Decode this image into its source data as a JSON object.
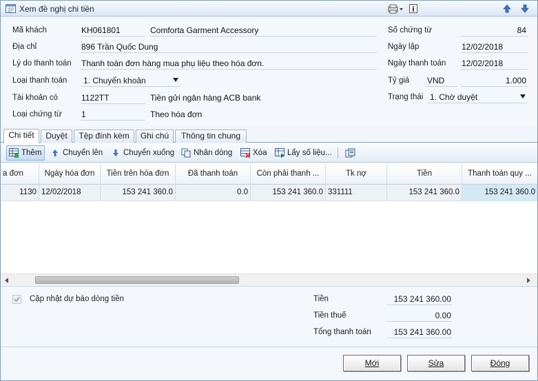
{
  "window": {
    "title": "Xem đề nghị chi tiền"
  },
  "form": {
    "customer_code_label": "Mã khách",
    "customer_code": "KH061801",
    "customer_name": "Comforta Garment Accessory",
    "address_label": "Địa chỉ",
    "address": "896 Trần Quốc Dung",
    "reason_label": "Lý do thanh toán",
    "reason": "Thanh toán đơn hàng mua phụ liệu theo hóa đơn.",
    "payment_type_label": "Loại thanh toán",
    "payment_type": "1. Chuyển khoản",
    "credit_account_label": "Tài khoản có",
    "credit_account": "1122TT",
    "credit_account_name": "Tiền gửi ngân hàng ACB bank",
    "doc_type_label": "Loại chứng từ",
    "doc_type": "1",
    "doc_type_name": "Theo hóa đơn",
    "voucher_no_label": "Số chứng từ",
    "voucher_no": "84",
    "created_date_label": "Ngày lập",
    "created_date": "12/02/2018",
    "payment_date_label": "Ngày thanh toán",
    "payment_date": "12/02/2018",
    "rate_label": "Tỷ giá",
    "currency": "VND",
    "rate": "1.000",
    "status_label": "Trạng thái",
    "status": "1. Chờ duyệt"
  },
  "tabs": [
    "Chi tiết",
    "Duyệt",
    "Tệp đính kèm",
    "Ghi chú",
    "Thông tin chung"
  ],
  "toolbar": {
    "add": "Thêm",
    "move_up": "Chuyển lên",
    "move_down": "Chuyển xuống",
    "copy_row": "Nhân dòng",
    "delete": "Xóa",
    "get_data": "Lấy số liệu..."
  },
  "grid": {
    "columns": [
      "a đơn",
      "Ngày hóa đơn",
      "Tiền trên hóa đơn",
      "Đã thanh toán",
      "Còn phải thanh ...",
      "Tk nợ",
      "Tiền",
      "Thanh toán quy ..."
    ],
    "rows": [
      [
        "1130",
        "12/02/2018",
        "153 241 360.0",
        "0.0",
        "153 241 360.0",
        "331111",
        "153 241 360.0",
        "153 241 360.0"
      ]
    ]
  },
  "bottom": {
    "cashflow_label": "Cập nhật dự báo dòng tiền",
    "cashflow_checked": true,
    "amount_label": "Tiền",
    "amount": "153 241 360.00",
    "tax_label": "Tiền thuế",
    "tax": "0.00",
    "total_label": "Tổng thanh toán",
    "total": "153 241 360.00"
  },
  "buttons": {
    "new": "Mới",
    "edit": "Sửa",
    "close": "Đóng"
  }
}
